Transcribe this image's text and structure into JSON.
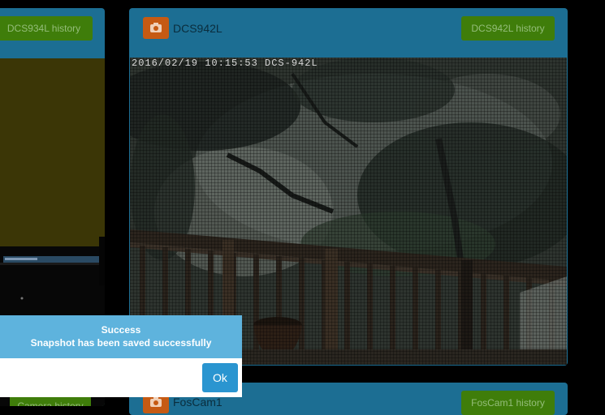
{
  "left_panel": {
    "history_label": "DCS934L history",
    "bottom_button_label": "Camera history"
  },
  "main_panel": {
    "title": "DCS942L",
    "history_label": "DCS942L history",
    "timestamp": "2016/02/19 10:15:53 DCS-942L",
    "camera_icon": "camera-icon"
  },
  "second_panel": {
    "title": "FosCam1",
    "history_label": "FosCam1 history",
    "camera_icon": "camera-icon"
  },
  "dialog": {
    "title": "Success",
    "message": "Snapshot has been saved successfully",
    "ok_label": "Ok"
  },
  "colors": {
    "panel": "#1c6e93",
    "history_button": "#3f7d0a",
    "camera_icon_bg": "#c65a13",
    "dialog_header": "#5eb3dd",
    "ok_button": "#2a95d0"
  }
}
